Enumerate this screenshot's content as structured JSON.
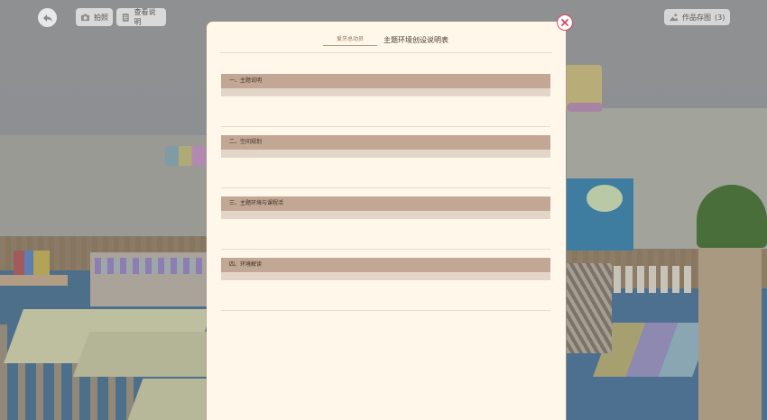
{
  "toolbar": {
    "photo_label": "拍照",
    "instructions_label": "查看说明",
    "saved_works_label": "作品存图",
    "saved_works_count": "(3)"
  },
  "modal": {
    "author_name": "爱牙总动员",
    "title": "主题环境创设说明表",
    "sections": [
      {
        "heading": "一、主题说明"
      },
      {
        "heading": "二、空间规划"
      },
      {
        "heading": "三、主题环境与课程活"
      },
      {
        "heading": "四、环境解读"
      }
    ]
  },
  "colors": {
    "modal_background": "#fff8ea",
    "section_bar": "#c2a795",
    "section_sub": "#e3d6c9",
    "close_accent": "#d94a5a"
  },
  "icons": {
    "back": "back-arrow-icon",
    "photo": "camera-icon",
    "instructions": "document-icon",
    "saved_works": "gallery-icon",
    "close": "close-icon"
  }
}
